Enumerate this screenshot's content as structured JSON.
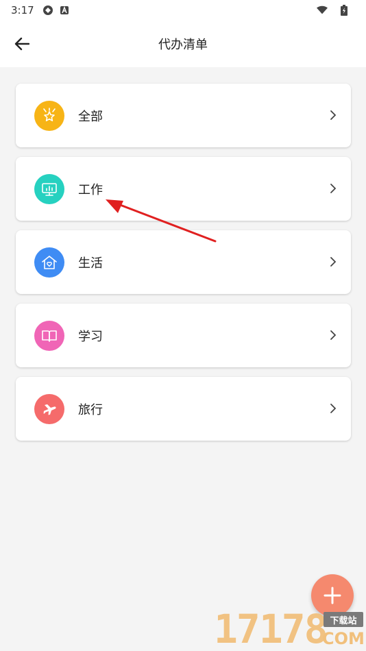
{
  "statusbar": {
    "time": "3:17"
  },
  "appbar": {
    "title": "代办清单"
  },
  "categories": [
    {
      "label": "全部",
      "color": "#f7b416",
      "icon": "star-badge-icon"
    },
    {
      "label": "工作",
      "color": "#26d1c0",
      "icon": "monitor-chart-icon"
    },
    {
      "label": "生活",
      "color": "#3f8cf4",
      "icon": "house-heart-icon"
    },
    {
      "label": "学习",
      "color": "#f065b6",
      "icon": "book-icon"
    },
    {
      "label": "旅行",
      "color": "#f56b6b",
      "icon": "airplane-icon"
    }
  ],
  "watermark": {
    "number": "17178",
    "badge": "下载站",
    "domain": "COM"
  },
  "annotation": {
    "color": "#e02020"
  }
}
